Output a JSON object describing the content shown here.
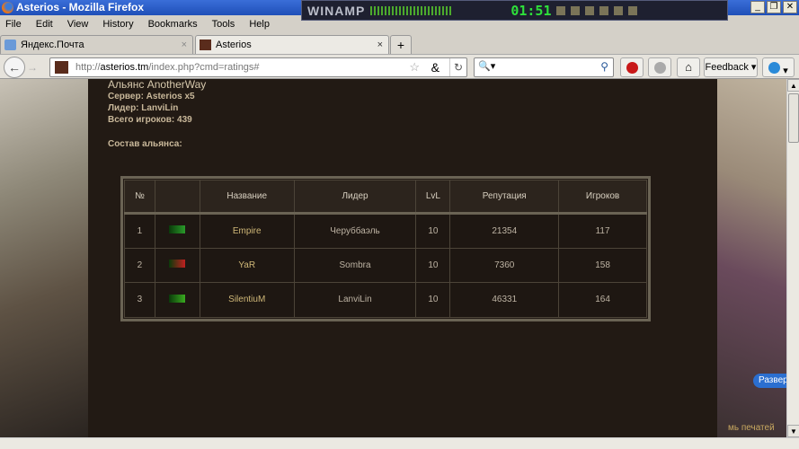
{
  "window": {
    "title": "Asterios - Mozilla Firefox"
  },
  "winamp": {
    "logo": "WINAMP",
    "time": "01:51"
  },
  "menu": [
    "File",
    "Edit",
    "View",
    "History",
    "Bookmarks",
    "Tools",
    "Help"
  ],
  "tabs": [
    {
      "label": "Яндекс.Почта",
      "active": false
    },
    {
      "label": "Asterios",
      "active": true
    }
  ],
  "nav": {
    "url_prefix": "http://",
    "url_host": "asterios.tm",
    "url_path": "/index.php?cmd=ratings#",
    "feedback_label": "Feedback"
  },
  "alliance": {
    "title": "Альянс AnotherWay",
    "server": "Сервер: Asterios x5",
    "leader": "Лидер: LanviLin",
    "total": "Всего игроков: 439",
    "composition": "Состав альянса:"
  },
  "table": {
    "headers": [
      "№",
      "",
      "Название",
      "Лидер",
      "LvL",
      "Репутация",
      "Игроков"
    ],
    "rows": [
      {
        "num": "1",
        "emblem_color": "#2a9a2a",
        "name": "Empire",
        "leader": "Черуббаэль",
        "lvl": "10",
        "rep": "21354",
        "players": "117"
      },
      {
        "num": "2",
        "emblem_color": "#c02020",
        "name": "YaR",
        "leader": "Sombra",
        "lvl": "10",
        "rep": "7360",
        "players": "158"
      },
      {
        "num": "3",
        "emblem_color": "#3aaa20",
        "name": "SilentiuM",
        "leader": "LanviLin",
        "lvl": "10",
        "rep": "46331",
        "players": "164"
      }
    ]
  },
  "side": {
    "expand_label": "Развер",
    "bottom_text": "мь печатей"
  }
}
